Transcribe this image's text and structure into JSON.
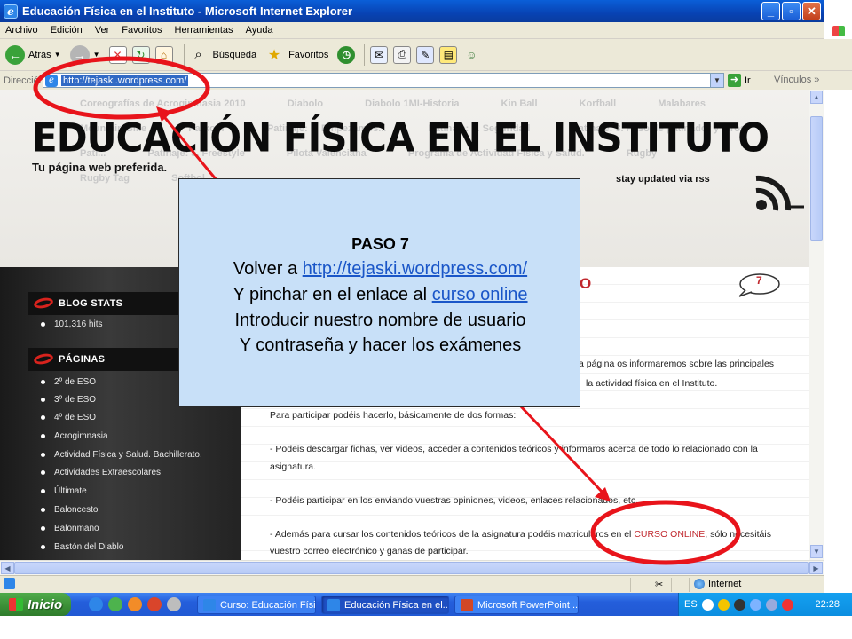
{
  "window": {
    "title": "Educación Física en el Instituto - Microsoft Internet Explorer"
  },
  "menu": [
    "Archivo",
    "Edición",
    "Ver",
    "Favoritos",
    "Herramientas",
    "Ayuda"
  ],
  "toolbar": {
    "back": "Atrás",
    "search": "Búsqueda",
    "favorites": "Favoritos"
  },
  "address": {
    "label": "Dirección",
    "url": "http://tejaski.wordpress.com/",
    "go": "Ir",
    "links": "Vínculos"
  },
  "site": {
    "nav_row1": [
      "Coreografías de Acrogimnasia 2010",
      "Diabolo",
      "Diabolo 1MI-Historia",
      "Kin Ball",
      "Korfball",
      "Malabares"
    ],
    "nav_row2": [
      "Mountain Bike",
      "Parkour",
      "Patinaje: 1. Empezamos...",
      "Patinaje: 2. Seguridad",
      "Patinaje: 3. Paso de patinador y giros"
    ],
    "nav_row3": [
      "Patí...",
      "Patinaje: 5. Freestyle",
      "Pilota Valenciana",
      "Programa de Actividad Física y Salud.",
      "Rugby"
    ],
    "nav_row4": [
      "Rugby Tag",
      "Softbol"
    ],
    "title": "EDUCACIÓN FÍSICA EN EL INSTITUTO",
    "tagline": "Tu página web preferida.",
    "stay_updated": "stay updated via rss"
  },
  "sidebar": {
    "blog_stats": {
      "heading": "BLOG STATS",
      "hits": "101,316 hits"
    },
    "pages": {
      "heading": "PÁGINAS",
      "items": [
        "2º de ESO",
        "3º de ESO",
        "4º de ESO",
        "Acrogimnasia",
        "Actividad Física y Salud. Bachillerato.",
        "Actividades Extraescolares",
        "Últimate",
        "Baloncesto",
        "Balonmano",
        "Bastón del Diablo"
      ]
    }
  },
  "post": {
    "title_fragment": "O",
    "comment_count": "7",
    "lines": [
      "a página os informaremos sobre las principales",
      "la actividad física en el Instituto.",
      "Para participar podéis hacerlo, básicamente de dos formas:",
      "- Podeis descargar fichas, ver videos, acceder a contenidos teóricos y informaros acerca de todo lo relacionado con la",
      "asignatura.",
      "- Podéis participar en los enviando vuestras opiniones, videos, enlaces relacionados, etc.",
      "- Además para cursar los contenidos teóricos de la asignatura podéis matricularos en el ",
      "CURSO ONLINE",
      ", sólo necesitáis",
      "vuestro correo electrónico y ganas de participar."
    ]
  },
  "status": {
    "zone": "Internet"
  },
  "taskbar": {
    "start": "Inicio",
    "tasks": [
      "Curso: Educación Físi...",
      "Educación Física en el...",
      "Microsoft PowerPoint ..."
    ],
    "lang": "ES",
    "clock": "22:28"
  },
  "slide": {
    "step": "PASO 7",
    "line1_prefix": "Volver a ",
    "line1_link": "http://tejaski.wordpress.com/",
    "line2_prefix": "Y pinchar en el enlace al ",
    "line2_link": "curso online",
    "line3": "Introducir nuestro nombre de usuario",
    "line4": "Y contraseña y hacer los exámenes"
  },
  "colors": {
    "annotation_red": "#e8141b",
    "link_blue": "#1a56c8",
    "xp_blue": "#0a5fd8",
    "box_bg": "#c8e0f8"
  }
}
